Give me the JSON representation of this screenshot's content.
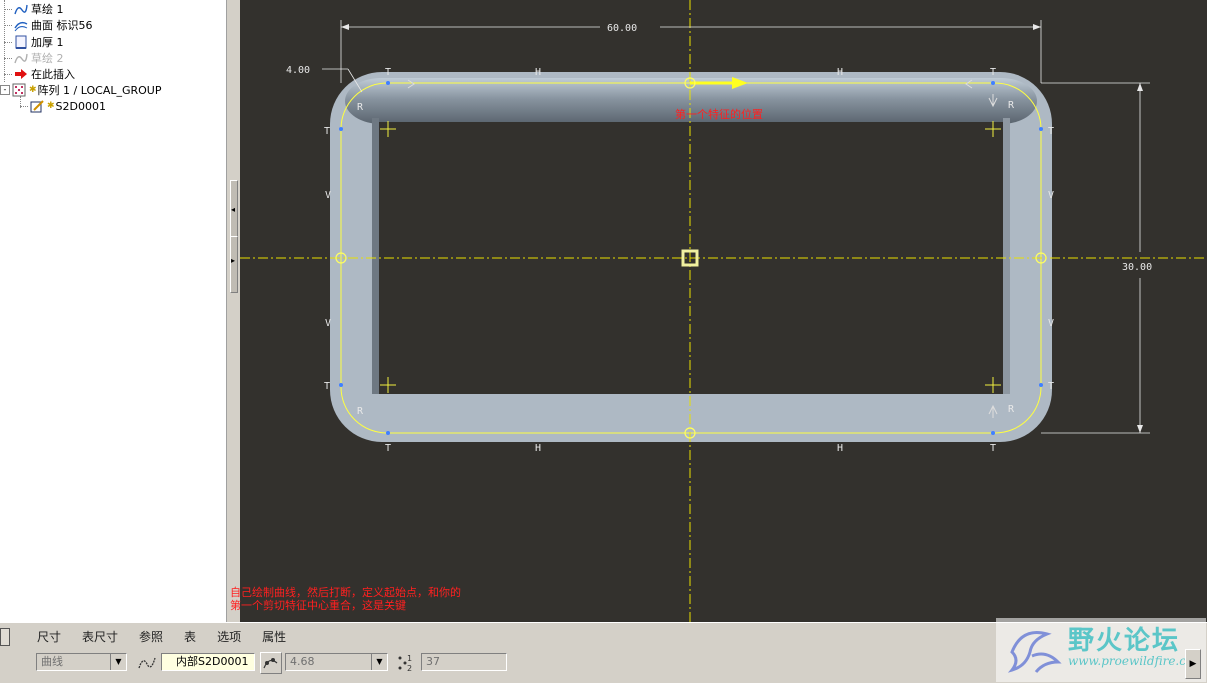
{
  "tree": {
    "items": [
      {
        "label": "草绘 1",
        "icon": "sketch-icon",
        "faded": false,
        "star": false
      },
      {
        "label": "曲面 标识56",
        "icon": "surface-icon",
        "faded": false,
        "star": false
      },
      {
        "label": "加厚 1",
        "icon": "thicken-icon",
        "faded": false,
        "star": false
      },
      {
        "label": "草绘 2",
        "icon": "sketch-icon",
        "faded": true,
        "star": false
      },
      {
        "label": "在此插入",
        "icon": "insert-arrow-icon",
        "faded": false,
        "star": false
      },
      {
        "label": "阵列 1 / LOCAL_GROUP",
        "icon": "pattern-icon",
        "faded": false,
        "star": true
      },
      {
        "label": "S2D0001",
        "icon": "sketch-edit-icon",
        "faded": false,
        "star": true
      }
    ]
  },
  "sketch": {
    "dim_width": "60.00",
    "dim_height": "30.00",
    "dim_thickness": "4.00",
    "start_point_label": "第一个特征的位置",
    "constraint_labels": {
      "tangent": "T",
      "horizontal": "H",
      "vertical": "V",
      "radius": "R"
    }
  },
  "note": {
    "line1": "自己绘制曲线，然后打断，定义起始点，和你的",
    "line2": "第一个剪切特征中心重合，这是关键"
  },
  "dashboard": {
    "tabs": [
      "尺寸",
      "表尺寸",
      "参照",
      "表",
      "选项",
      "属性"
    ],
    "curve_type": "曲线",
    "curve_ref": "内部S2D0001",
    "spacing_value": "4.68",
    "count_value": "37"
  },
  "logo": {
    "name": "野火论坛",
    "url": "www.proewildfire.cn"
  },
  "colors": {
    "canvas_bg": "#33312d",
    "axis": "#e8e000",
    "note": "#ff2020",
    "sketch_line": "#ffff40",
    "solid": "#a8b4c0"
  }
}
